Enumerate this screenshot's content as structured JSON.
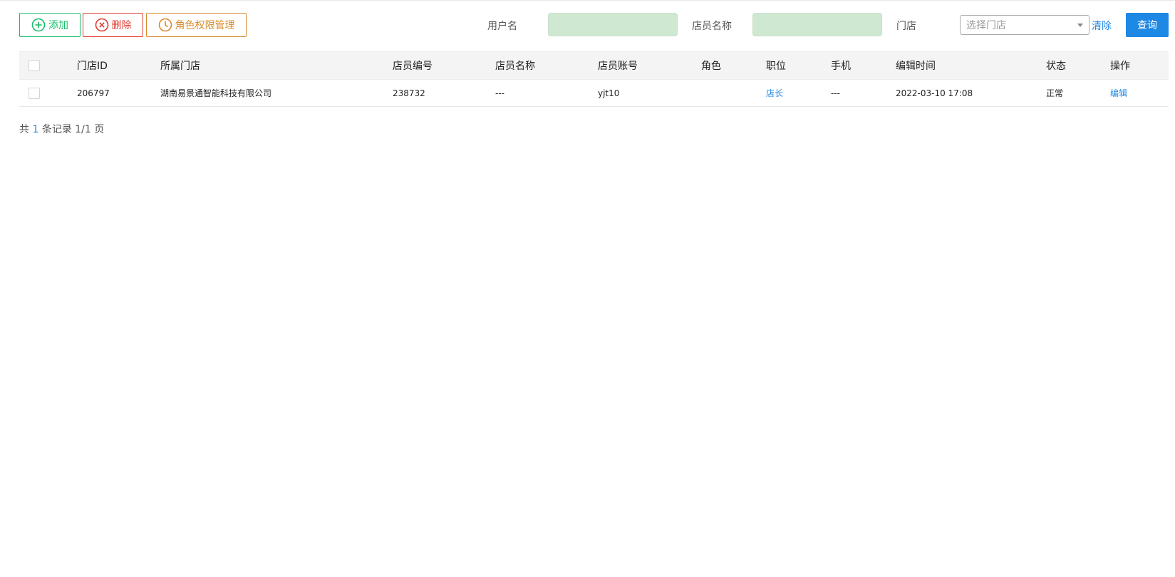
{
  "toolbar": {
    "add_label": "添加",
    "delete_label": "删除",
    "role_label": "角色权限管理"
  },
  "filters": {
    "username_label": "用户名",
    "username_value": "",
    "staff_name_label": "店员名称",
    "staff_name_value": "",
    "store_label": "门店",
    "store_placeholder": "选择门店",
    "clear_label": "清除",
    "query_label": "查询"
  },
  "table": {
    "headers": {
      "store_id": "门店ID",
      "store": "所属门店",
      "staff_no": "店员编号",
      "staff_name": "店员名称",
      "account": "店员账号",
      "role": "角色",
      "position": "职位",
      "phone": "手机",
      "edit_time": "编辑时间",
      "status": "状态",
      "operation": "操作"
    },
    "rows": [
      {
        "store_id": "206797",
        "store": "湖南易景通智能科技有限公司",
        "staff_no": "238732",
        "staff_name": "---",
        "account": "yjt10",
        "role": "",
        "position": "店长",
        "phone": "---",
        "edit_time": "2022-03-10 17:08",
        "status": "正常",
        "operation": "编辑"
      }
    ]
  },
  "pagination": {
    "prefix": "共",
    "count": "1",
    "suffix": "条记录 1/1 页"
  },
  "colors": {
    "add": "#19be6b",
    "delete": "#e03c32",
    "role": "#d98a2b",
    "primary": "#1e88e5",
    "input_bg": "#cfe8d1"
  }
}
